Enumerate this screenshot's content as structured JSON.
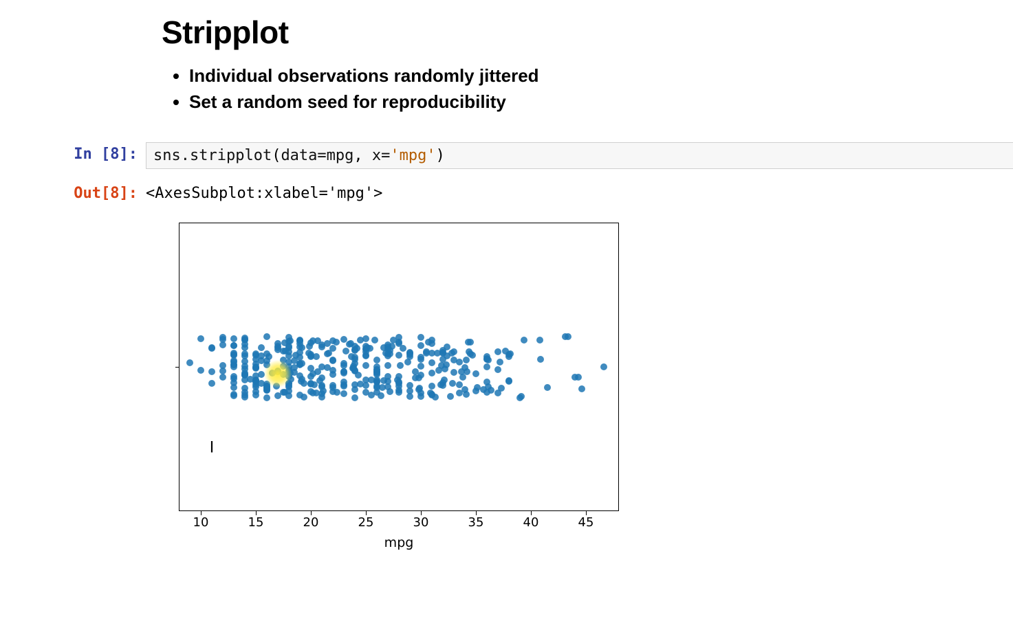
{
  "header": {
    "title": "Stripplot",
    "bullets": [
      "Individual observations randomly jittered",
      "Set a random seed for reproducibility"
    ]
  },
  "cell": {
    "in_prompt": "In [8]:",
    "out_prompt": "Out[8]:",
    "code_tokens": {
      "fn": "sns.stripplot",
      "open": "(",
      "arg1_name": "data",
      "eq1": "=",
      "arg1_val": "mpg",
      "sep": ", ",
      "arg2_name": "x",
      "eq2": "=",
      "arg2_val": "'mpg'",
      "close": ")"
    },
    "output_text": "<AxesSubplot:xlabel='mpg'>"
  },
  "cursor_glyph": "I",
  "chart_data": {
    "type": "strip",
    "title": "",
    "xlabel": "mpg",
    "ylabel": "",
    "xlim": [
      8,
      48
    ],
    "xticks": [
      10,
      15,
      20,
      25,
      30,
      35,
      40,
      45
    ],
    "highlight_x": 17,
    "x": [
      18,
      15,
      18,
      16,
      17,
      15,
      14,
      14,
      14,
      15,
      15,
      14,
      15,
      14,
      24,
      22,
      18,
      21,
      27,
      26,
      25,
      24,
      25,
      26,
      21,
      10,
      10,
      11,
      9,
      27,
      28,
      25,
      25,
      19,
      16,
      17,
      19,
      18,
      14,
      14,
      14,
      14,
      12,
      13,
      13,
      18,
      22,
      19,
      18,
      23,
      28,
      30,
      30,
      30,
      31,
      35,
      27,
      26,
      24,
      25,
      23,
      20,
      21,
      13,
      14,
      15,
      14,
      17,
      11,
      13,
      12,
      13,
      19,
      15,
      13,
      13,
      14,
      18,
      22,
      21,
      26,
      22,
      28,
      23,
      28,
      27,
      13,
      14,
      13,
      14,
      15,
      12,
      13,
      13,
      14,
      13,
      12,
      13,
      18,
      16,
      18,
      18,
      23,
      26,
      11,
      12,
      13,
      12,
      18,
      20,
      21,
      22,
      18,
      19,
      21,
      26,
      15,
      16,
      29,
      24,
      20,
      19,
      15,
      24,
      20,
      11,
      20,
      21,
      19,
      15,
      31,
      26,
      32,
      25,
      16,
      16,
      18,
      16,
      13,
      14,
      14,
      14,
      29,
      26,
      26,
      31,
      32,
      28,
      24,
      26,
      24,
      26,
      31,
      19,
      18,
      15,
      15,
      16,
      15,
      16,
      14,
      17,
      16,
      15,
      18,
      21,
      20,
      13,
      29,
      23,
      20,
      23,
      24,
      25,
      24,
      18,
      29,
      19,
      23,
      23,
      22,
      25,
      33,
      28,
      25,
      25,
      26,
      27,
      17.5,
      16,
      15.5,
      14.5,
      22,
      24,
      24.5,
      29,
      33,
      20,
      18,
      18.5,
      17.5,
      29.5,
      32,
      28,
      26.5,
      20,
      13,
      19,
      19,
      31,
      30,
      36,
      25.5,
      33.5,
      17.5,
      17,
      15.5,
      15,
      17.5,
      20.5,
      19,
      18.5,
      16,
      15.5,
      15.5,
      16,
      29,
      24.5,
      26,
      25.5,
      30.5,
      33.5,
      30,
      30.5,
      22,
      21.5,
      21.5,
      43.1,
      36.1,
      32.8,
      39.4,
      36.1,
      19.9,
      19.4,
      20.2,
      19.2,
      25.1,
      20.5,
      19.4,
      20.6,
      20.8,
      18.6,
      18.1,
      19.2,
      17.7,
      18.1,
      17.5,
      30,
      27.5,
      27.2,
      30.9,
      21.1,
      23.2,
      23.8,
      23.9,
      20.3,
      17,
      21.6,
      16.2,
      31.5,
      29.5,
      21.5,
      19.8,
      22.3,
      20.2,
      20.6,
      17,
      17.6,
      16.5,
      18.2,
      16.9,
      15.5,
      19.2,
      18.5,
      31.9,
      34.1,
      35.7,
      27.4,
      25.4,
      23,
      27.2,
      23.9,
      34.2,
      34.5,
      31.8,
      37.3,
      28.4,
      28.8,
      26.8,
      33.5,
      41.5,
      38.1,
      32.1,
      37.2,
      28,
      26.4,
      24.3,
      19.1,
      34.3,
      29.8,
      31.3,
      37,
      32.2,
      46.6,
      27.9,
      40.8,
      44.3,
      43.4,
      36.4,
      30,
      44.6,
      40.9,
      33.8,
      29.8,
      32.7,
      23.7,
      35,
      23.6,
      32.4,
      27.2,
      26.6,
      25.8,
      23.5,
      30,
      39.1,
      39,
      35.1,
      32.3,
      37,
      37.7,
      34.1,
      34.7,
      34.4,
      29.9,
      33,
      34.5,
      33.7,
      32.4,
      32.9,
      31.6,
      28.1,
      30.7,
      24.2,
      22.4,
      26.6,
      20.2,
      17.6,
      28,
      27,
      34,
      31,
      29,
      27,
      24,
      23,
      36,
      37,
      31,
      38,
      36,
      36,
      36,
      34,
      38,
      32,
      38,
      25,
      38,
      26,
      22,
      32,
      36,
      27,
      27,
      44,
      32,
      28,
      31
    ]
  }
}
